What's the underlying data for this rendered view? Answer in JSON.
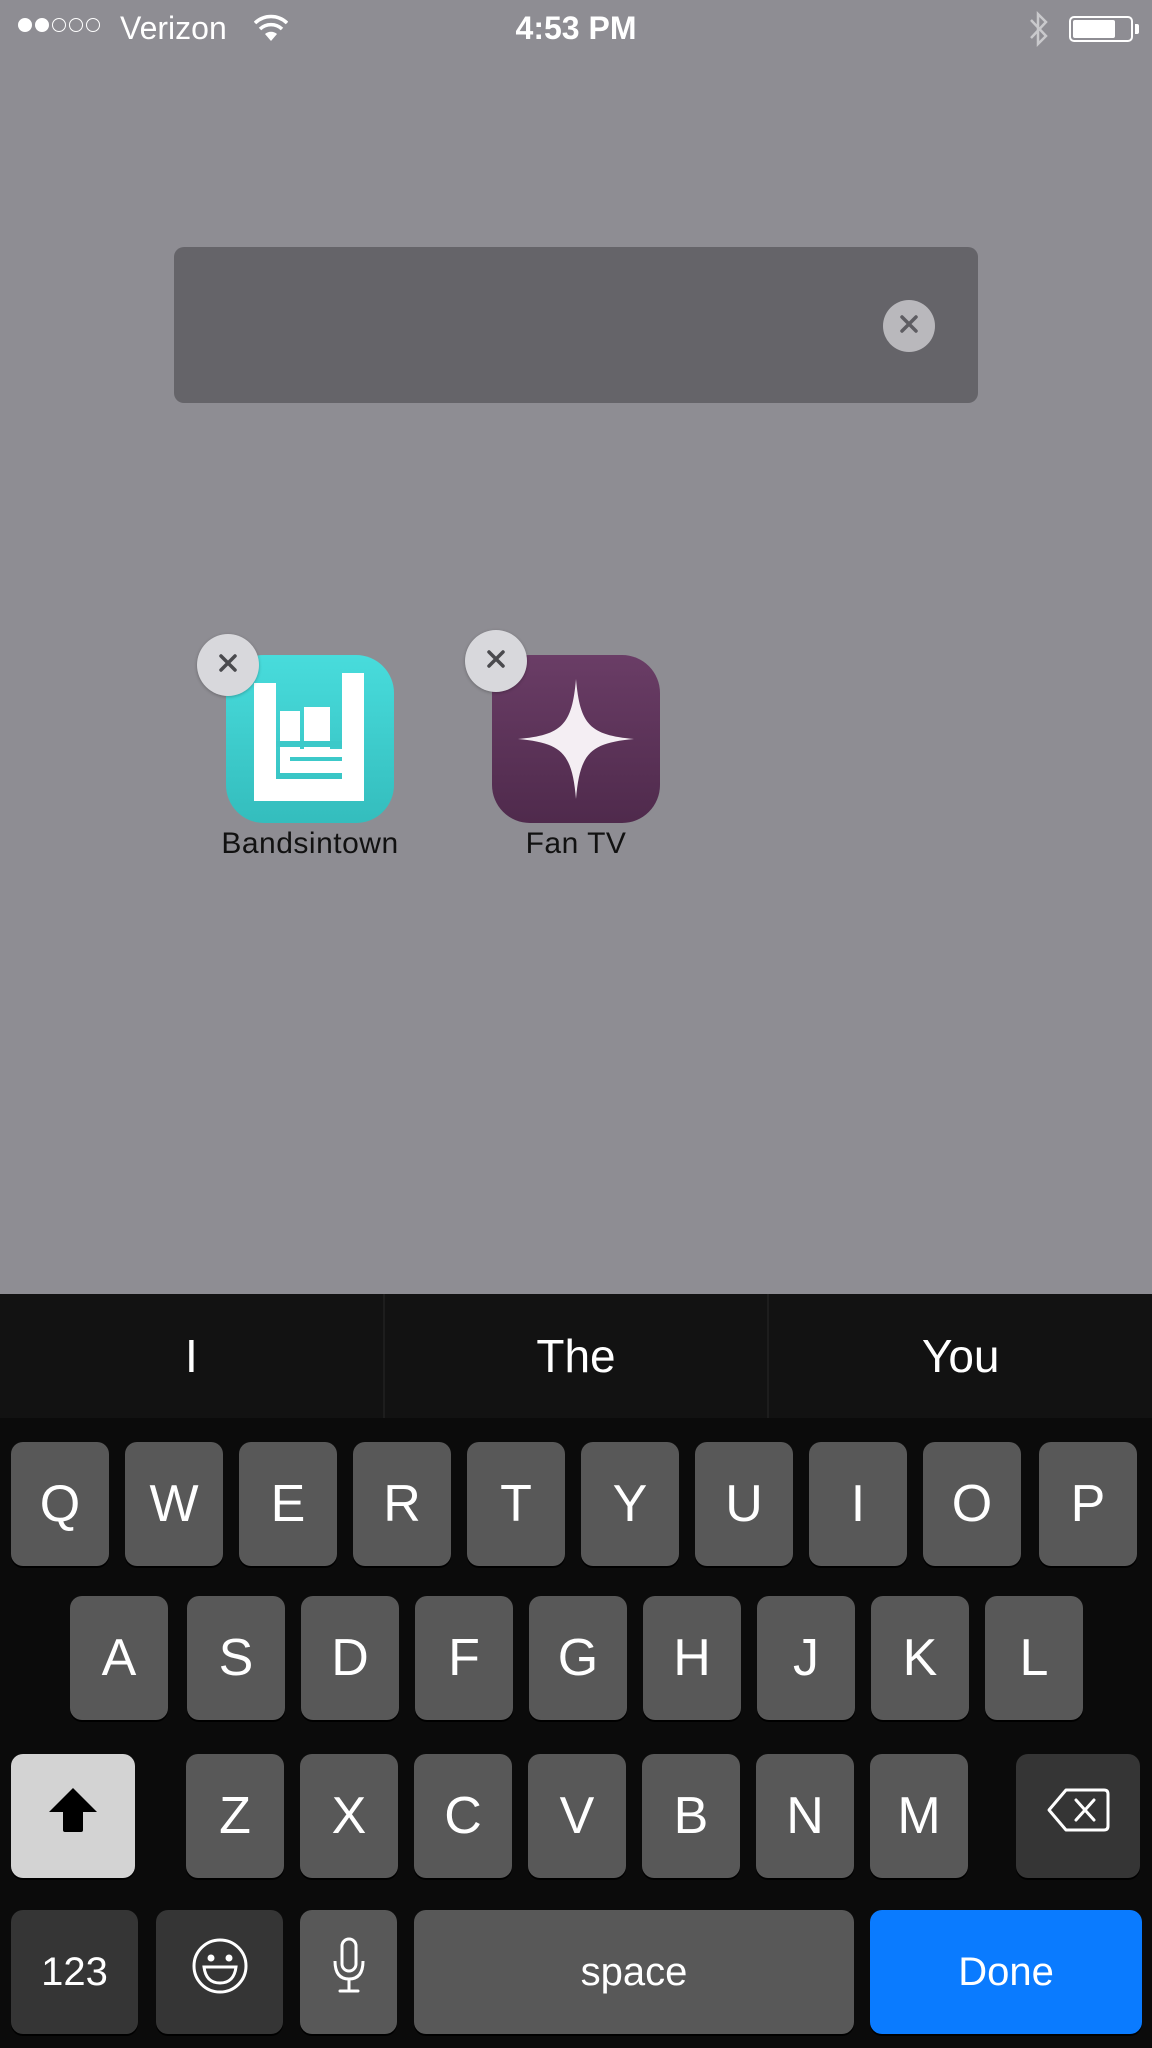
{
  "status_bar": {
    "signal_strength": {
      "filled": 2,
      "total": 5
    },
    "carrier": "Verizon",
    "time": "4:53 PM",
    "wifi_icon": "wifi-icon",
    "bluetooth_icon": "bluetooth-icon",
    "battery_level": 0.75
  },
  "search": {
    "value": "",
    "clear_icon": "clear-icon"
  },
  "apps": [
    {
      "name": "Bandsintown",
      "icon": "bandsintown-icon",
      "color": "#3fcfcf",
      "delete_icon": "delete-icon"
    },
    {
      "name": "Fan TV",
      "icon": "fan-tv-star-icon",
      "color": "#5a3156",
      "delete_icon": "delete-icon"
    }
  ],
  "keyboard": {
    "suggestions": [
      "I",
      "The",
      "You"
    ],
    "rows": [
      [
        "Q",
        "W",
        "E",
        "R",
        "T",
        "Y",
        "U",
        "I",
        "O",
        "P"
      ],
      [
        "A",
        "S",
        "D",
        "F",
        "G",
        "H",
        "J",
        "K",
        "L"
      ],
      [
        "Z",
        "X",
        "C",
        "V",
        "B",
        "N",
        "M"
      ]
    ],
    "shift_icon": "shift-icon",
    "delete_icon": "backspace-icon",
    "numbers_label": "123",
    "emoji_icon": "emoji-icon",
    "mic_icon": "microphone-icon",
    "space_label": "space",
    "done_label": "Done",
    "done_color": "#0a7bff"
  }
}
